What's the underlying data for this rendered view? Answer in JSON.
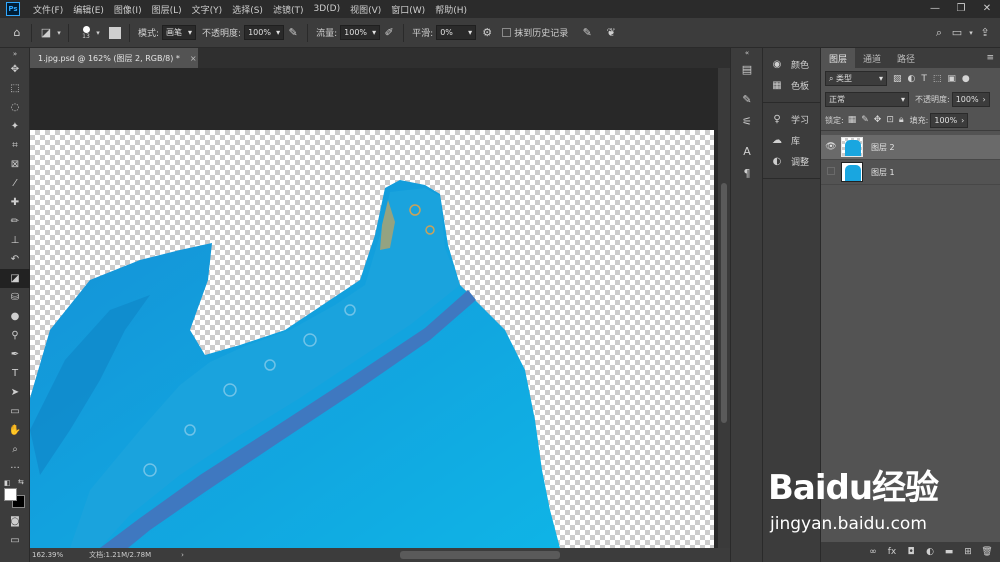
{
  "app": {
    "logo": "Ps"
  },
  "menu": [
    "文件(F)",
    "编辑(E)",
    "图像(I)",
    "图层(L)",
    "文字(Y)",
    "选择(S)",
    "滤镜(T)",
    "3D(D)",
    "视图(V)",
    "窗口(W)",
    "帮助(H)"
  ],
  "window_controls": {
    "minimize": "—",
    "restore": "❐",
    "close": "✕"
  },
  "options": {
    "brush_size": "13",
    "mode_label": "模式:",
    "mode_value": "画笔",
    "opacity_label": "不透明度:",
    "opacity_value": "100%",
    "flow_label": "流量:",
    "flow_value": "100%",
    "smoothing_label": "平滑:",
    "smoothing_value": "0%",
    "erase_history_label": "抹到历史记录"
  },
  "document": {
    "tab_title": "1.jpg.psd @ 162% (图层 2, RGB/8) *",
    "close": "×"
  },
  "status": {
    "zoom": "162.39%",
    "doc_info": "文档:1.21M/2.78M",
    "arrow": "›"
  },
  "mini_panels": {
    "group1": [
      {
        "icon": "color-icon",
        "label": "颜色"
      },
      {
        "icon": "swatches-icon",
        "label": "色板"
      }
    ],
    "group2": [
      {
        "icon": "learn-icon",
        "label": "学习"
      },
      {
        "icon": "libraries-icon",
        "label": "库"
      },
      {
        "icon": "adjustments-icon",
        "label": "调整"
      }
    ]
  },
  "layers_panel": {
    "tabs": [
      "图层",
      "通道",
      "路径"
    ],
    "filter_kind": "类型",
    "blend_mode": "正常",
    "opacity_label": "不透明度:",
    "opacity_value": "100%",
    "lock_label": "锁定:",
    "fill_label": "填充:",
    "fill_value": "100%",
    "layers": [
      {
        "name": "图层 2",
        "visible": true,
        "selected": true
      },
      {
        "name": "图层 1",
        "visible": false,
        "selected": false
      }
    ]
  },
  "watermark": {
    "logo_text": "Baidu经验",
    "url": "jingyan.baidu.com"
  },
  "colors": {
    "accent": "#31a8ff",
    "garment": "#19a6e0",
    "panel": "#535353"
  }
}
